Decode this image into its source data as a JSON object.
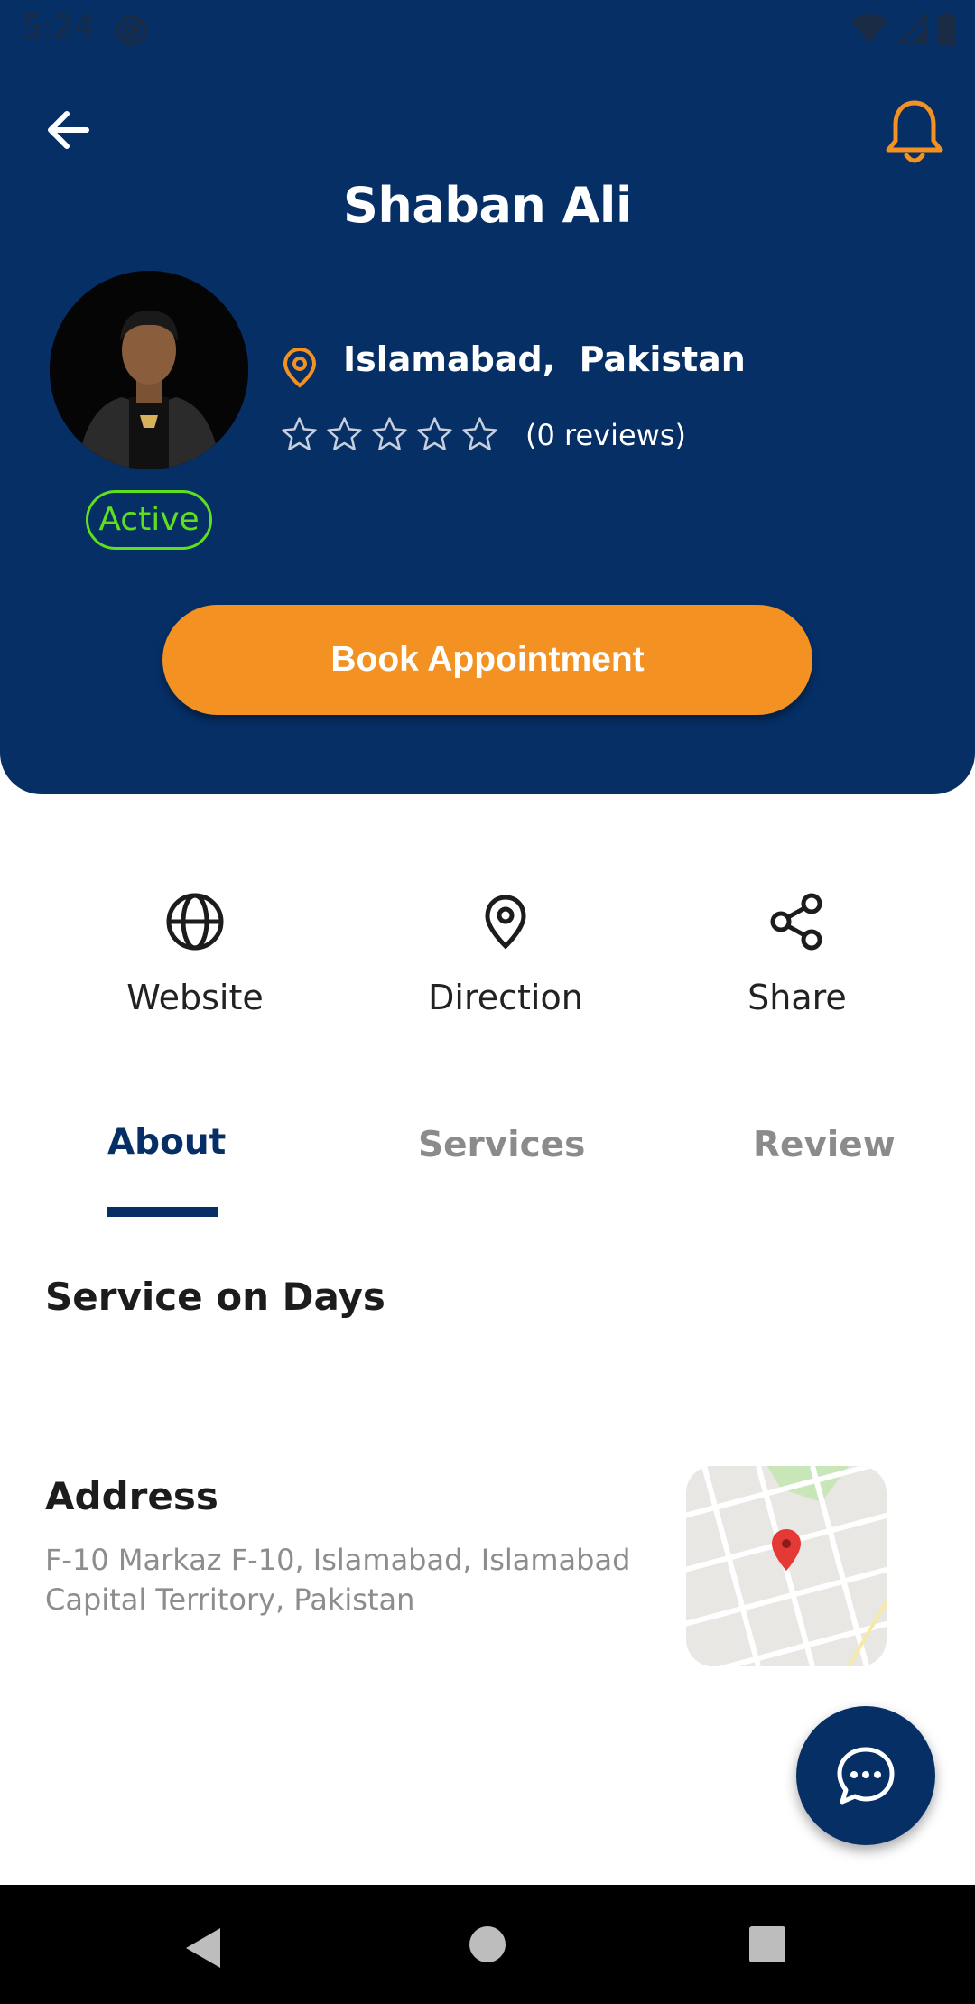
{
  "status_bar": {
    "time": "5:24"
  },
  "profile": {
    "name": "Shaban Ali",
    "status": "Active",
    "location": "Islamabad,  Pakistan",
    "rating": 0,
    "reviews_label": "(0 reviews)"
  },
  "book_button": {
    "label": "Book Appointment"
  },
  "actions": {
    "website": "Website",
    "direction": "Direction",
    "share": "Share"
  },
  "tabs": {
    "about": "About",
    "services": "Services",
    "review": "Review",
    "active": "About"
  },
  "about": {
    "service_days_title": "Service on Days",
    "address_title": "Address",
    "address_text": "F-10 Markaz F-10, Islamabad, Islamabad Capital Territory, Pakistan"
  },
  "colors": {
    "primary": "#062f66",
    "accent": "#f39223",
    "active_green": "#5fe01c"
  },
  "icons": {
    "back": "arrow-left-icon",
    "bell": "bell-icon",
    "location": "map-pin-icon",
    "star": "star-outline-icon",
    "website": "globe-icon",
    "direction": "map-pin-icon",
    "share": "share-icon",
    "chat": "chat-bubble-icon"
  }
}
